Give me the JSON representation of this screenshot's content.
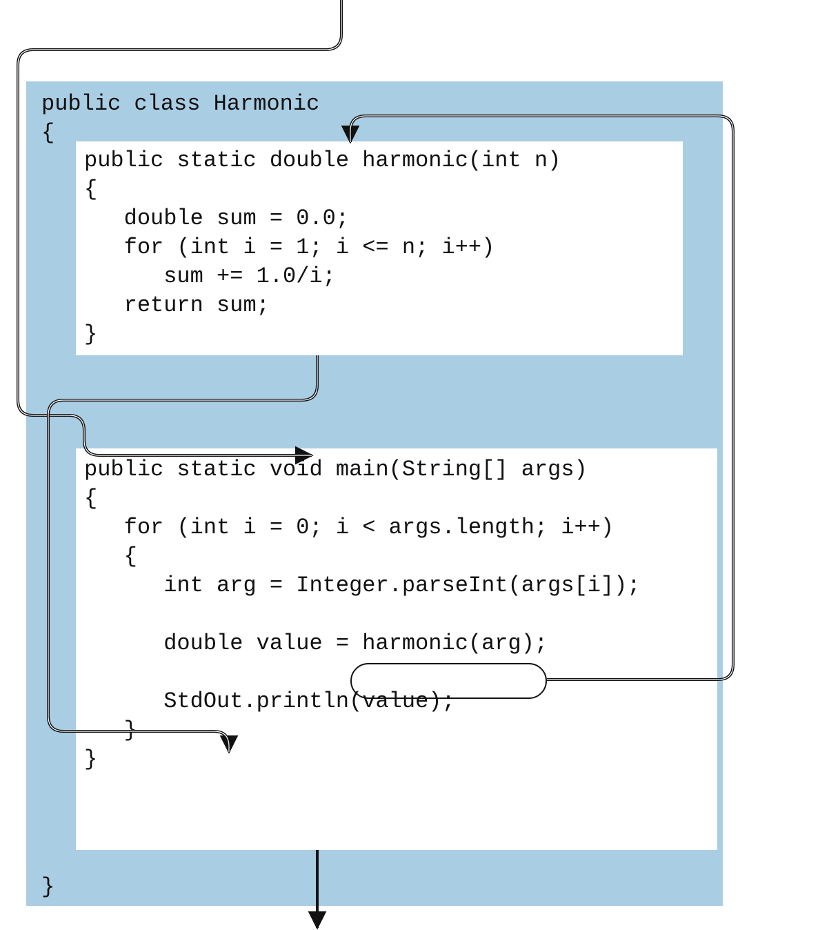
{
  "colors": {
    "panel": "#a9cde3",
    "box": "#ffffff",
    "ink": "#111111"
  },
  "class_header": "public class Harmonic\n{",
  "class_footer": "}",
  "harmonic_method": "public static double harmonic(int n)\n{\n   double sum = 0.0;\n   for (int i = 1; i <= n; i++)\n      sum += 1.0/i;\n   return sum;\n}",
  "main_method": "public static void main(String[] args)\n{\n   for (int i = 0; i < args.length; i++)\n   {\n      int arg = Integer.parseInt(args[i]);\n\n      double value = harmonic(arg);\n\n      StdOut.println(value);\n   }\n}",
  "called_expression": "harmonic(arg);"
}
